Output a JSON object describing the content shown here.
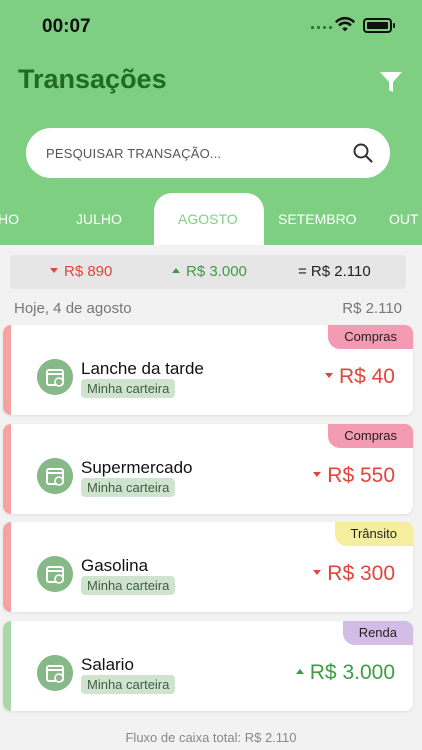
{
  "status": {
    "time": "00:07"
  },
  "header": {
    "title": "Transações"
  },
  "search": {
    "placeholder": "PESQUISAR TRANSAÇÃO..."
  },
  "months": [
    "HO",
    "JULHO",
    "AGOSTO",
    "SETEMBRO",
    "OUT"
  ],
  "active_month": "AGOSTO",
  "summary": {
    "expense": "R$ 890",
    "income": "R$ 3.000",
    "balance": "= R$ 2.110"
  },
  "date_group": {
    "label": "Hoje, 4 de agosto",
    "total": "R$ 2.110"
  },
  "transactions": [
    {
      "title": "Lanche da tarde",
      "wallet": "Minha carteira",
      "category": "Compras",
      "amount": "R$ 40",
      "type": "expense",
      "stripe": "#f4a3a1",
      "tag_color": "#f29bb3"
    },
    {
      "title": "Supermercado",
      "wallet": "Minha carteira",
      "category": "Compras",
      "amount": "R$ 550",
      "type": "expense",
      "stripe": "#f4a3a1",
      "tag_color": "#f29bb3"
    },
    {
      "title": "Gasolina",
      "wallet": "Minha carteira",
      "category": "Trânsito",
      "amount": "R$ 300",
      "type": "expense",
      "stripe": "#f4a3a1",
      "tag_color": "#f5ee9e"
    },
    {
      "title": "Salario",
      "wallet": "Minha carteira",
      "category": "Renda",
      "amount": "R$ 3.000",
      "type": "income",
      "stripe": "#a9d8a6",
      "tag_color": "#d3bde6"
    }
  ],
  "footer": {
    "text": "Fluxo de caixa total: R$ 2.110"
  }
}
